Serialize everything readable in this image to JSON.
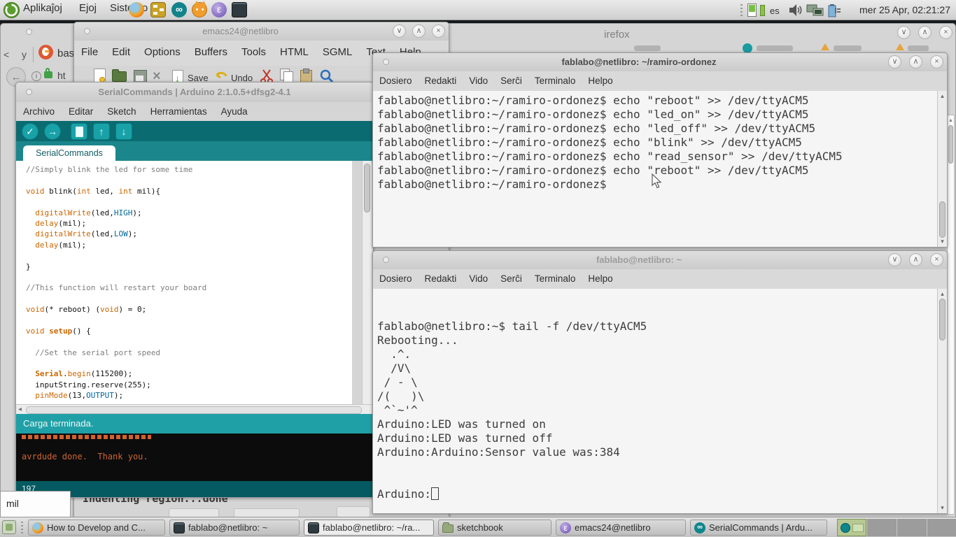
{
  "panel": {
    "menus": [
      "Aplikaĵoj",
      "Ejoj",
      "Sistemo"
    ],
    "launchers": [
      "firefox",
      "diagram-editor",
      "arduino",
      "scratch",
      "emacs",
      "terminal"
    ],
    "tray": {
      "icons": [
        "battery-meter",
        "battery-bar",
        "keyboard-layout",
        "volume",
        "network",
        "power"
      ],
      "keyboard_layout": "es",
      "clock": "mer 25 Apr, 02:21:27"
    }
  },
  "glyphs": {
    "min": "∨",
    "max": "∧",
    "close": "×",
    "check": "✓",
    "upload": "→",
    "up": "↑",
    "down": "↓",
    "back": "←",
    "left_arrow": "◂",
    "sb_up": "▴",
    "sb_down": "▾",
    "infinity": "∞",
    "epsilon": "ε",
    "prev_tab": "<"
  },
  "firefox": {
    "title_tail": "irefox",
    "tab_prev_fragment": "y",
    "tab_label": "bash",
    "url_fragment": "ht"
  },
  "emacs": {
    "title": "emacs24@netlibro",
    "menus": [
      "File",
      "Edit",
      "Options",
      "Buffers",
      "Tools",
      "HTML",
      "SGML",
      "Text",
      "Help"
    ],
    "toolbar": {
      "save_label": "Save",
      "undo_label": "Undo"
    },
    "echo_line": "Indenting region...done",
    "minibuffer_fragment": "mil"
  },
  "arduino": {
    "title": "SerialCommands | Arduino 2:1.0.5+dfsg2-4.1",
    "menus": [
      "Archivo",
      "Editar",
      "Sketch",
      "Herramientas",
      "Ayuda"
    ],
    "tab": "SerialCommands",
    "status": "Carga terminada.",
    "console_done": "avrdude done.  Thank you.",
    "line_number": "197",
    "colors": {
      "keyword": "#cc6600",
      "constant": "#006699",
      "comment": "#7e7e7e",
      "teal_band": "#0a6b71",
      "teal_button": "#18a2a8",
      "status_teal": "#1fa0a6",
      "bottom_teal": "#045a60",
      "console_orange": "#cf6532"
    },
    "code_lines": [
      [
        [
          "comment",
          "//Simply blink the led for some time"
        ]
      ],
      [],
      [
        [
          "kw",
          "void"
        ],
        [
          "plain",
          " blink("
        ],
        [
          "kw",
          "int"
        ],
        [
          "plain",
          " led, "
        ],
        [
          "kw",
          "int"
        ],
        [
          "plain",
          " mil){"
        ]
      ],
      [],
      [
        [
          "plain",
          "  "
        ],
        [
          "fn",
          "digitalWrite"
        ],
        [
          "plain",
          "(led,"
        ],
        [
          "const",
          "HIGH"
        ],
        [
          "plain",
          ");"
        ]
      ],
      [
        [
          "plain",
          "  "
        ],
        [
          "fn",
          "delay"
        ],
        [
          "plain",
          "(mil);"
        ]
      ],
      [
        [
          "plain",
          "  "
        ],
        [
          "fn",
          "digitalWrite"
        ],
        [
          "plain",
          "(led,"
        ],
        [
          "const",
          "LOW"
        ],
        [
          "plain",
          ");"
        ]
      ],
      [
        [
          "plain",
          "  "
        ],
        [
          "fn",
          "delay"
        ],
        [
          "plain",
          "(mil);"
        ]
      ],
      [],
      [
        [
          "plain",
          "}"
        ]
      ],
      [],
      [
        [
          "comment",
          "//This function will restart your board"
        ]
      ],
      [],
      [
        [
          "kw",
          "void"
        ],
        [
          "plain",
          "(* reboot) ("
        ],
        [
          "kw",
          "void"
        ],
        [
          "plain",
          ") = 0;"
        ]
      ],
      [],
      [
        [
          "kw",
          "void"
        ],
        [
          "plain",
          " "
        ],
        [
          "fnb",
          "setup"
        ],
        [
          "plain",
          "() {"
        ]
      ],
      [],
      [
        [
          "plain",
          "  "
        ],
        [
          "comment",
          "//Set the serial port speed"
        ]
      ],
      [],
      [
        [
          "plain",
          "  "
        ],
        [
          "fnb",
          "Serial"
        ],
        [
          "plain",
          "."
        ],
        [
          "fn",
          "begin"
        ],
        [
          "plain",
          "(115200);"
        ]
      ],
      [
        [
          "plain",
          "  inputString.reserve(255);"
        ]
      ],
      [
        [
          "plain",
          "  "
        ],
        [
          "fn",
          "pinMode"
        ],
        [
          "plain",
          "(13,"
        ],
        [
          "const",
          "OUTPUT"
        ],
        [
          "plain",
          ");"
        ]
      ]
    ]
  },
  "terminal1": {
    "title": "fablabo@netlibro: ~/ramiro-ordonez",
    "menus": [
      "Dosiero",
      "Redakti",
      "Vido",
      "Serĉi",
      "Terminalo",
      "Helpo"
    ],
    "lines": [
      "fablabo@netlibro:~/ramiro-ordonez$ echo \"reboot\" >> /dev/ttyACM5",
      "fablabo@netlibro:~/ramiro-ordonez$ echo \"led_on\" >> /dev/ttyACM5",
      "fablabo@netlibro:~/ramiro-ordonez$ echo \"led_off\" >> /dev/ttyACM5",
      "fablabo@netlibro:~/ramiro-ordonez$ echo \"blink\" >> /dev/ttyACM5",
      "fablabo@netlibro:~/ramiro-ordonez$ echo \"read_sensor\" >> /dev/ttyACM5",
      "fablabo@netlibro:~/ramiro-ordonez$ echo \"reboot\" >> /dev/ttyACM5",
      "fablabo@netlibro:~/ramiro-ordonez$"
    ]
  },
  "terminal2": {
    "title": "fablabo@netlibro: ~",
    "menus": [
      "Dosiero",
      "Redakti",
      "Vido",
      "Serĉi",
      "Terminalo",
      "Helpo"
    ],
    "lines": [
      "fablabo@netlibro:~$ tail -f /dev/ttyACM5",
      "Rebooting...",
      "  .^.",
      "  /V\\",
      " / - \\",
      "/(   )\\",
      " ^`~'^",
      "Arduino:LED was turned on",
      "Arduino:LED was turned off",
      "Arduino:Arduino:Sensor value was:384"
    ],
    "cursor_line": "Arduino:"
  },
  "taskbar": {
    "buttons": [
      {
        "icon": "firefox",
        "label": "How to Develop and C...",
        "active": false
      },
      {
        "icon": "terminal",
        "label": "fablabo@netlibro: ~",
        "active": false
      },
      {
        "icon": "terminal",
        "label": "fablabo@netlibro: ~/ra...",
        "active": true
      },
      {
        "icon": "folder",
        "label": "sketchbook",
        "active": false
      },
      {
        "icon": "emacs",
        "label": "emacs24@netlibro",
        "active": false
      },
      {
        "icon": "arduino",
        "label": "SerialCommands | Ardu...",
        "active": false
      }
    ],
    "workspaces": 4,
    "current_workspace": 1
  }
}
